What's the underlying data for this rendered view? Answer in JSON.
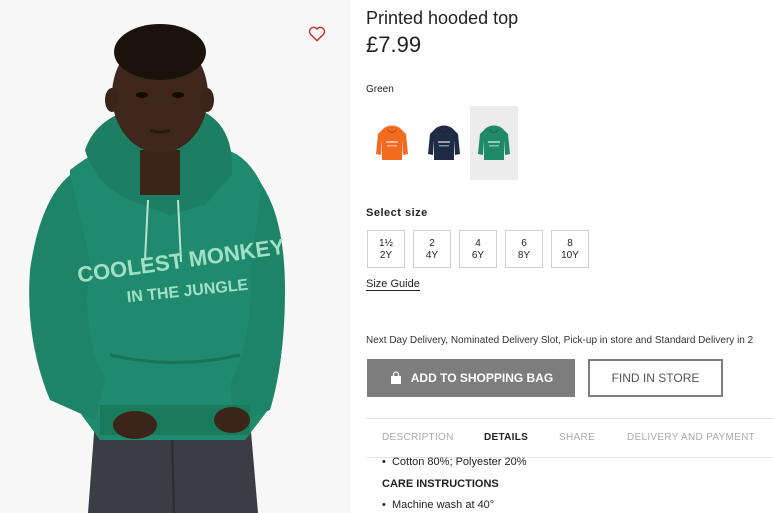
{
  "product": {
    "title": "Printed hooded top",
    "price": "£7.99",
    "favourite_icon": "heart-outline-icon",
    "hoodie_print_line1": "COOLEST MONKEY",
    "hoodie_print_line2": "IN THE JUNGLE"
  },
  "colors": {
    "label": "Green",
    "swatches": [
      {
        "name": "orange",
        "color": "#f46a1f",
        "selected": false
      },
      {
        "name": "navy",
        "color": "#1f2b45",
        "selected": false
      },
      {
        "name": "green",
        "color": "#1e8a68",
        "selected": true
      }
    ]
  },
  "sizes": {
    "title": "Select size",
    "options": [
      {
        "line1": "1½",
        "line2": "2Y"
      },
      {
        "line1": "2",
        "line2": "4Y"
      },
      {
        "line1": "4",
        "line2": "6Y"
      },
      {
        "line1": "6",
        "line2": "8Y"
      },
      {
        "line1": "8",
        "line2": "10Y"
      }
    ],
    "guide": "Size Guide"
  },
  "delivery_text": "Next Day Delivery, Nominated Delivery Slot, Pick-up in store and Standard Delivery in 2",
  "actions": {
    "add_to_bag": "ADD TO SHOPPING BAG",
    "bag_icon": "shopping-bag-icon",
    "find_in_store": "FIND IN STORE"
  },
  "tabs": [
    {
      "label": "DESCRIPTION",
      "active": false
    },
    {
      "label": "DETAILS",
      "active": true
    },
    {
      "label": "SHARE",
      "active": false
    },
    {
      "label": "DELIVERY AND PAYMENT",
      "active": false
    }
  ],
  "details": {
    "composition": "Cotton 80%; Polyester 20%",
    "care_heading": "CARE INSTRUCTIONS",
    "care_item": "Machine wash at 40°"
  }
}
